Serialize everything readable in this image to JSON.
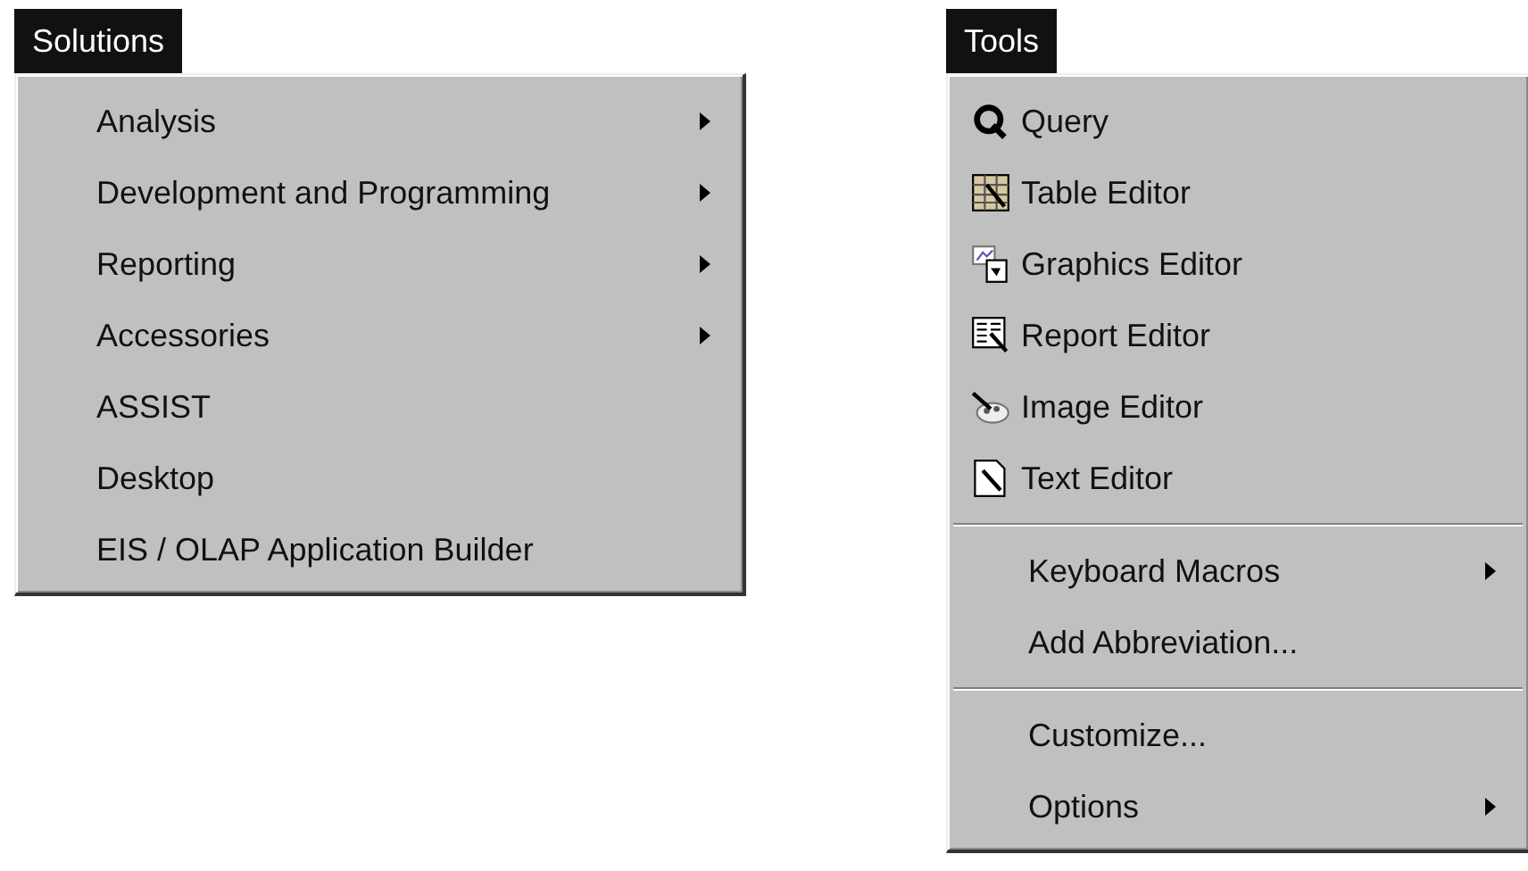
{
  "menus": [
    {
      "title": "Solutions",
      "groups": [
        {
          "items": [
            {
              "label": "Analysis",
              "submenu": true
            },
            {
              "label": "Development and Programming",
              "submenu": true
            },
            {
              "label": "Reporting",
              "submenu": true
            },
            {
              "label": "Accessories",
              "submenu": true
            },
            {
              "label": "ASSIST",
              "submenu": false
            },
            {
              "label": "Desktop",
              "submenu": false
            },
            {
              "label": "EIS / OLAP Application Builder",
              "submenu": false
            }
          ]
        }
      ]
    },
    {
      "title": "Tools",
      "groups": [
        {
          "items": [
            {
              "label": "Query",
              "submenu": false,
              "kind": "icon"
            },
            {
              "label": "Table Editor",
              "submenu": false,
              "kind": "icon"
            },
            {
              "label": "Graphics Editor",
              "submenu": false,
              "kind": "icon"
            },
            {
              "label": "Report Editor",
              "submenu": false,
              "kind": "icon"
            },
            {
              "label": "Image Editor",
              "submenu": false,
              "kind": "icon"
            },
            {
              "label": "Text Editor",
              "submenu": false,
              "kind": "icon"
            }
          ]
        },
        {
          "items": [
            {
              "label": "Keyboard Macros",
              "submenu": true
            },
            {
              "label": "Add Abbreviation...",
              "submenu": false
            }
          ]
        },
        {
          "items": [
            {
              "label": "Customize...",
              "submenu": false
            },
            {
              "label": "Options",
              "submenu": true
            }
          ]
        }
      ]
    }
  ]
}
